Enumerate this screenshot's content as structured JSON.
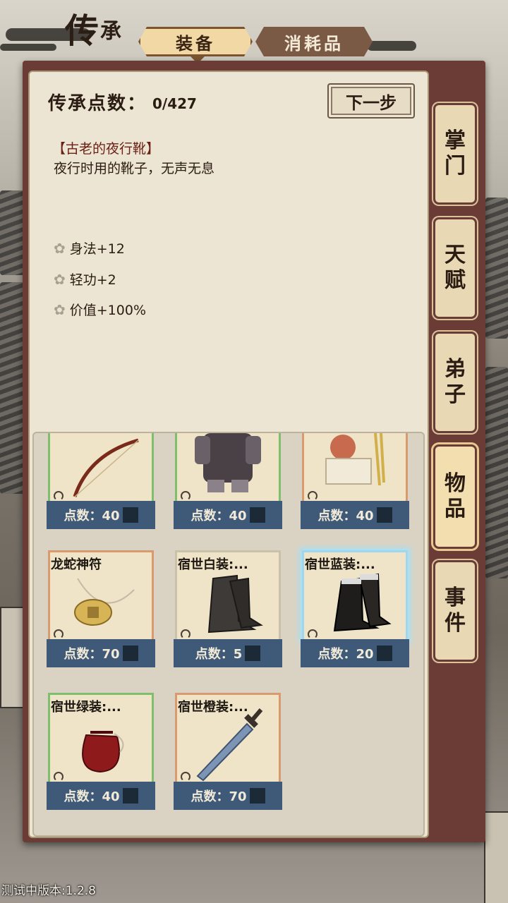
{
  "header": {
    "title_big": "传",
    "title_small": "承"
  },
  "tabs": [
    {
      "label": "装备",
      "active": true
    },
    {
      "label": "消耗品",
      "active": false
    }
  ],
  "points": {
    "label": "传承点数：",
    "value": "0/427"
  },
  "next_button": "下一步",
  "selected_item": {
    "name": "【古老的夜行靴】",
    "description": "夜行时用的靴子，无声无息",
    "stats": [
      "身法+12",
      "轻功+2",
      "价值+100%"
    ]
  },
  "items": [
    {
      "name": "",
      "points": "点数：40",
      "rarity": "green",
      "icon": "bow-icon"
    },
    {
      "name": "",
      "points": "点数：40",
      "rarity": "green",
      "icon": "armor-icon"
    },
    {
      "name": "",
      "points": "点数：40",
      "rarity": "orange",
      "icon": "seal-icon"
    },
    {
      "name": "龙蛇神符",
      "points": "点数：70",
      "rarity": "orange",
      "icon": "amulet-icon"
    },
    {
      "name": "宿世白装:...",
      "points": "点数：5",
      "rarity": "plain",
      "icon": "boots-icon"
    },
    {
      "name": "宿世蓝装:...",
      "points": "点数：20",
      "rarity": "blue",
      "icon": "boots-icon"
    },
    {
      "name": "宿世绿装:...",
      "points": "点数：40",
      "rarity": "green",
      "icon": "pouch-icon"
    },
    {
      "name": "宿世橙装:...",
      "points": "点数：70",
      "rarity": "orange",
      "icon": "sword-icon"
    }
  ],
  "side_tabs": [
    {
      "label": [
        "掌",
        "门"
      ],
      "active": false
    },
    {
      "label": [
        "天",
        "赋"
      ],
      "active": false
    },
    {
      "label": [
        "弟",
        "子"
      ],
      "active": false
    },
    {
      "label": [
        "物",
        "品"
      ],
      "active": true
    },
    {
      "label": [
        "事",
        "件"
      ],
      "active": false
    }
  ],
  "version": "测试中版本:1.2.8",
  "colors": {
    "panel": "#ede5d3",
    "frame": "#6b3b35",
    "points_bar": "#3e5a78"
  }
}
